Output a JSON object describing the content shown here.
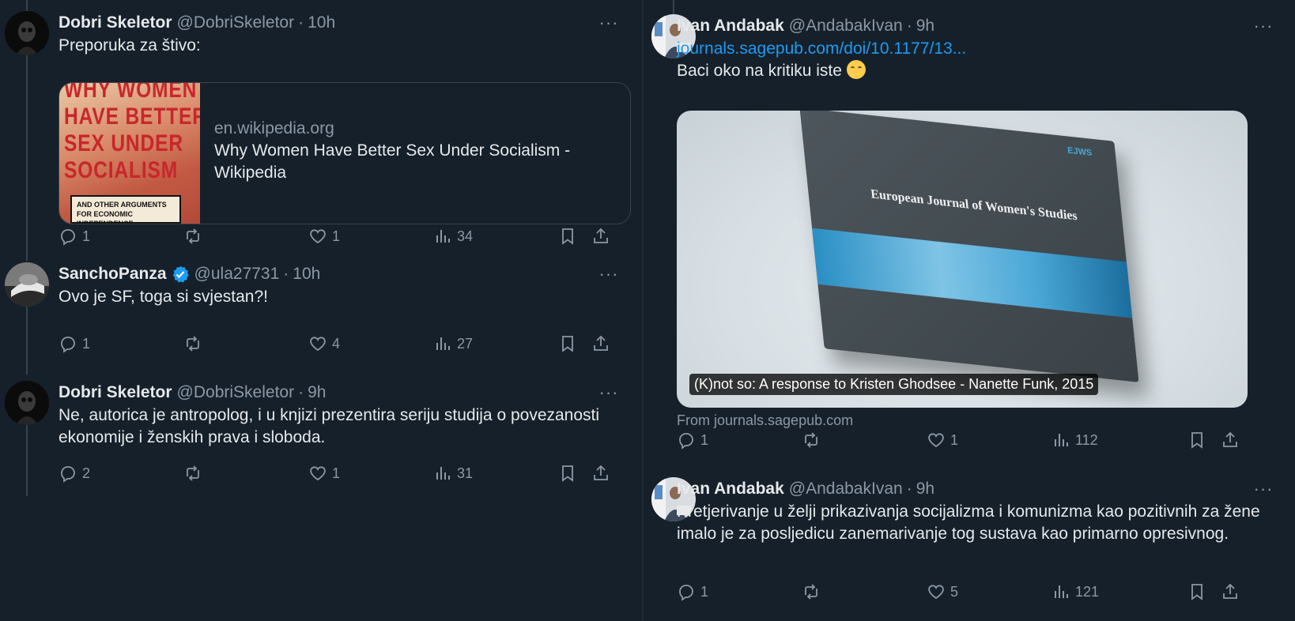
{
  "left_column": {
    "tweets": [
      {
        "name": "Dobri Skeletor",
        "handle": "@DobriSkeletor",
        "separator": "·",
        "time": "10h",
        "text": "Preporuka za štivo:",
        "card": {
          "cover_lines": [
            "WHY WOMEN",
            "HAVE BETTER",
            "SEX UNDER",
            "SOCIALISM"
          ],
          "cover_subtitle": "AND OTHER ARGUMENTS FOR ECONOMIC INDEPENDENCE",
          "domain": "en.wikipedia.org",
          "title": "Why Women Have Better Sex Under Socialism - Wikipedia"
        },
        "replies": "1",
        "reposts": "",
        "likes": "1",
        "views": "34"
      },
      {
        "name": "SanchoPanza",
        "handle": "@ula27731",
        "separator": "·",
        "time": "10h",
        "text": "Ovo je SF, toga si svjestan?!",
        "replies": "1",
        "reposts": "",
        "likes": "4",
        "views": "27"
      },
      {
        "name": "Dobri Skeletor",
        "handle": "@DobriSkeletor",
        "separator": "·",
        "time": "9h",
        "text": "Ne, autorica je antropolog, i u knjizi prezentira seriju studija o povezanosti ekonomije i ženskih prava i sloboda.",
        "replies": "2",
        "reposts": "",
        "likes": "1",
        "views": "31"
      }
    ]
  },
  "right_column": {
    "tweets": [
      {
        "name": "Ivan Andabak",
        "handle": "@AndabakIvan",
        "separator": "·",
        "time": "9h",
        "link": "journals.sagepub.com/doi/10.1177/13...",
        "text": "Baci oko na kritiku iste",
        "media": {
          "journal_tag": "EJWS",
          "journal_title": "European Journal of Women's Studies",
          "caption": "(K)not so: A response to Kristen Ghodsee - Nanette Funk, 2015"
        },
        "from": "From journals.sagepub.com",
        "replies": "1",
        "reposts": "",
        "likes": "1",
        "views": "112"
      },
      {
        "name": "Ivan Andabak",
        "handle": "@AndabakIvan",
        "separator": "·",
        "time": "9h",
        "text": "Pretjerivanje u želji prikazivanja socijalizma i komunizma kao pozitivnih za žene imalo je za  posljedicu zanemarivanje tog sustava kao primarno opresivnog.",
        "replies": "1",
        "reposts": "",
        "likes": "5",
        "views": "121"
      }
    ]
  },
  "more_label": "···",
  "colors": {
    "background": "#15202b",
    "text": "#e7e9ea",
    "muted": "#8b98a5",
    "accent": "#1d9bf0",
    "border": "#38444d"
  },
  "icons": [
    "reply-icon",
    "repost-icon",
    "like-icon",
    "views-icon",
    "bookmark-icon",
    "share-icon",
    "more-icon",
    "verified-icon"
  ]
}
